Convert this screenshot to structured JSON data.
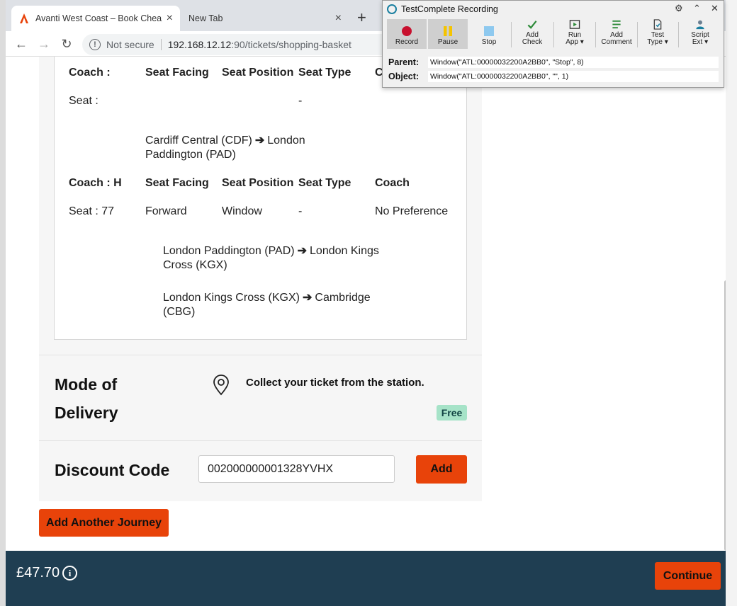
{
  "browser": {
    "tabs": [
      {
        "title": "Avanti West Coast – Book Cheap",
        "close": "×"
      },
      {
        "title": "New Tab",
        "close": "×"
      }
    ],
    "new_tab": "+",
    "security": "Not secure",
    "url_host": "192.168.12.12",
    "url_path": ":90/tickets/shopping-basket",
    "nav": {
      "back": "←",
      "forward": "→",
      "reload": "↻"
    }
  },
  "seats": {
    "coach1": {
      "coach": "Coach :",
      "facing": "Seat Facing",
      "position": "Seat Position",
      "type": "Seat Type",
      "coach_col": "C",
      "seat": "Seat :",
      "type_val": "-"
    },
    "leg1": {
      "from": "Cardiff Central (CDF)",
      "arrow": "➔",
      "to_a": "London",
      "to_b": "Paddington (PAD)"
    },
    "coach2": {
      "coach": "Coach : H",
      "facing": "Seat Facing",
      "position": "Seat Position",
      "type": "Seat Type",
      "coach_col": "Coach",
      "seat": "Seat : 77",
      "facing_val": "Forward",
      "position_val": "Window",
      "type_val": "-",
      "coach_val": "No Preference"
    },
    "leg2": {
      "from": "London Paddington (PAD)",
      "arrow": "➔",
      "to_a": "London Kings",
      "to_b": "Cross (KGX)"
    },
    "leg3": {
      "from": "London Kings Cross (KGX)",
      "arrow": "➔",
      "to_a": "Cambridge",
      "to_b": "(CBG)"
    }
  },
  "delivery": {
    "label_a": "Mode of",
    "label_b": "Delivery",
    "text": "Collect your ticket from the station.",
    "badge": "Free"
  },
  "discount": {
    "label": "Discount Code",
    "value": "002000000001328YVHX",
    "add": "Add"
  },
  "add_journey": "Add Another Journey",
  "footer": {
    "price": "£47.70",
    "info": "i",
    "continue": "Continue"
  },
  "testcomplete": {
    "title": "TestComplete Recording",
    "controls": {
      "settings": "⚙",
      "collapse": "⌃",
      "close": "✕"
    },
    "buttons": [
      {
        "l1": "Record",
        "l2": ""
      },
      {
        "l1": "Pause",
        "l2": ""
      },
      {
        "l1": "Stop",
        "l2": ""
      },
      {
        "l1": "Add",
        "l2": "Check"
      },
      {
        "l1": "Run",
        "l2": "App ▾"
      },
      {
        "l1": "Add",
        "l2": "Comment"
      },
      {
        "l1": "Test",
        "l2": "Type ▾"
      },
      {
        "l1": "Script",
        "l2": "Ext ▾"
      }
    ],
    "parent_label": "Parent:",
    "parent_value": "Window(\"ATL:00000032200A2BB0\", \"Stop\", 8)",
    "object_label": "Object:",
    "object_value": "Window(\"ATL:00000032200A2BB0\", \"\", 1)",
    "colors": {
      "record": "#c8102e",
      "pause": "#f5c400",
      "stop": "#8ec9ef"
    }
  },
  "colors": {
    "brand": "#e8430a",
    "footer": "#1f3e52",
    "free_badge": "#a6e3c8"
  }
}
